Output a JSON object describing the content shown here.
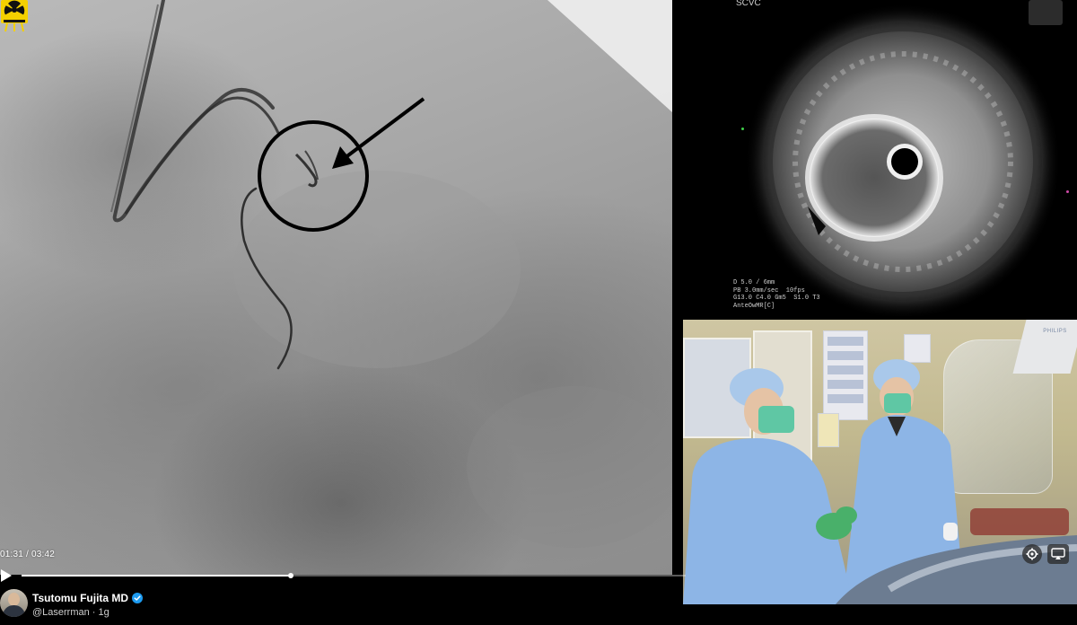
{
  "video": {
    "current_time": "01:31",
    "separator": " / ",
    "duration": "03:42",
    "progress_fraction": 0.405
  },
  "ivus": {
    "label": "SCVC",
    "readout_lines": [
      "D 5.0 / 6mm",
      "PB 3.0mm/sec  10fps",
      "G13.0 C4.0 Gm5  S1.0 T3",
      "AnteOwMR[C]"
    ]
  },
  "camera": {
    "brand_label": "PHILIPS"
  },
  "author": {
    "name": "Tsutomu Fujita MD",
    "handle": "@Laserrman",
    "dot": " · ",
    "age": "1g"
  },
  "colors": {
    "verified": "#1d9bf0",
    "radiation_yellow": "#f4d000",
    "scrub_blue": "#8db5e6",
    "mask_green": "#5fc7a4"
  },
  "icons": {
    "play": "play-icon",
    "settings": "gear-icon",
    "fullscreen": "fullscreen-icon",
    "radiation": "radiation-warning-icon",
    "verified": "verified-badge-icon"
  }
}
